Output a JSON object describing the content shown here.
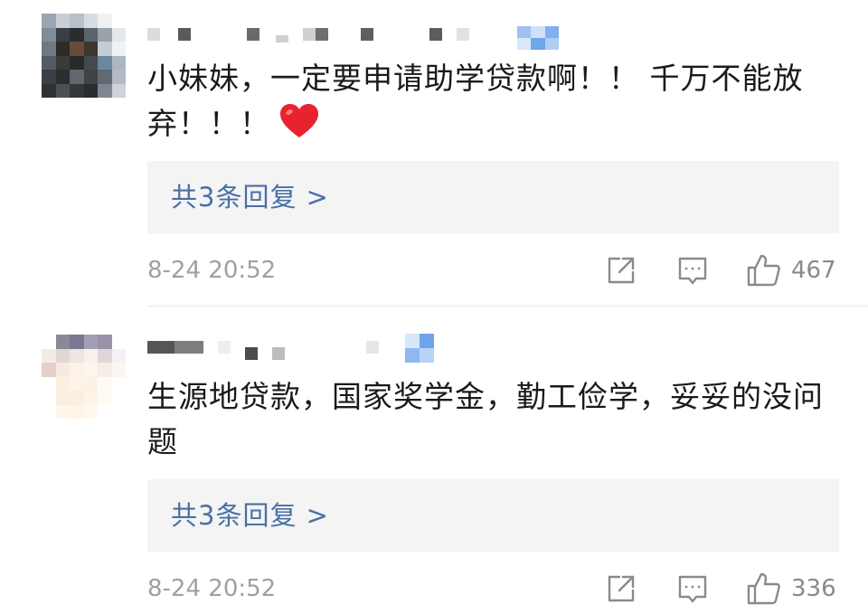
{
  "comments": [
    {
      "content": "小妹妹，一定要申请助学贷款啊！！ 千万不能放弃！！！",
      "reply_label": "共3条回复 >",
      "timestamp": "8-24 20:52",
      "likes": "467"
    },
    {
      "content": "生源地贷款，国家奖学金，勤工俭学，妥妥的没问题",
      "reply_label": "共3条回复 >",
      "timestamp": "8-24 20:52",
      "likes": "336"
    }
  ],
  "icons": {
    "heart": "heart-icon",
    "share": "share-icon",
    "comment": "comment-icon",
    "like": "thumbs-up-icon"
  },
  "colors": {
    "reply_link": "#4a6fa5",
    "reply_bg": "#f4f4f4",
    "heart": "#e8222e",
    "meta_text": "#a0a0a0"
  }
}
